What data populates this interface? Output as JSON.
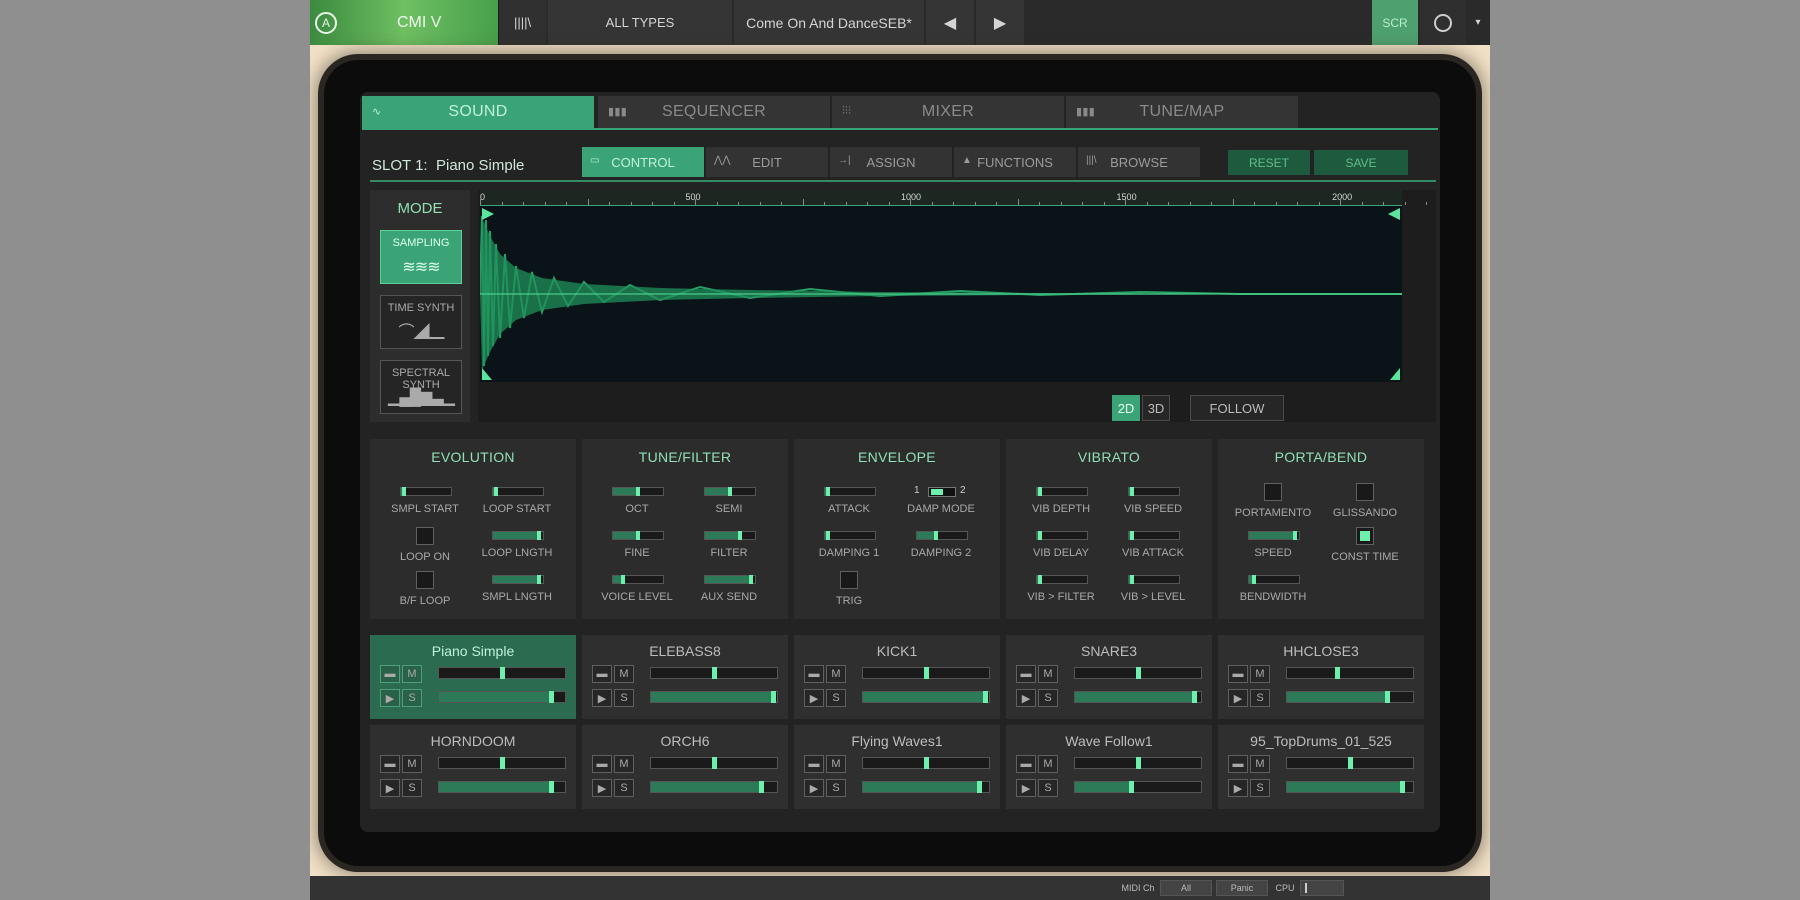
{
  "topbar": {
    "logo_glyph": "A",
    "app_name": "CMI V",
    "library_icon": "||||\\",
    "type_filter": "ALL TYPES",
    "preset_name": "Come On And DanceSEB*",
    "prev_icon": "◀",
    "next_icon": "▶",
    "scr_label": "SCR",
    "menu_icon": "▾"
  },
  "main_tabs": [
    {
      "label": "SOUND",
      "icon": "∿",
      "active": true
    },
    {
      "label": "SEQUENCER",
      "icon": "▮▮▮",
      "active": false
    },
    {
      "label": "MIXER",
      "icon": "⫶⫶⫶",
      "active": false
    },
    {
      "label": "TUNE/MAP",
      "icon": "▮▮▮",
      "active": false
    }
  ],
  "slot": {
    "label": "SLOT 1:",
    "name": "Piano Simple"
  },
  "sub_tabs": [
    {
      "label": "CONTROL",
      "icon": "▭",
      "active": true
    },
    {
      "label": "EDIT",
      "icon": "⋀⋀",
      "active": false
    },
    {
      "label": "ASSIGN",
      "icon": "→|",
      "active": false
    },
    {
      "label": "FUNCTIONS",
      "icon": "▲",
      "active": false
    },
    {
      "label": "BROWSE",
      "icon": "|||\\",
      "active": false
    }
  ],
  "slot_buttons": {
    "reset": "RESET",
    "save": "SAVE"
  },
  "mode": {
    "title": "MODE",
    "options": [
      {
        "label": "SAMPLING",
        "glyph": "≋≋≋",
        "active": true
      },
      {
        "label": "TIME SYNTH",
        "glyph": "⌒◢▁",
        "active": false
      },
      {
        "label": "SPECTRAL SYNTH",
        "glyph": "▁▄█▆▃▁",
        "active": false
      }
    ]
  },
  "waveform": {
    "ruler_ticks": [
      "0",
      "500",
      "1000",
      "1500",
      "2000"
    ],
    "view_2d": "2D",
    "view_3d": "3D",
    "follow": "FOLLOW",
    "active_view": "2D"
  },
  "sections": [
    {
      "title": "EVOLUTION",
      "controls": [
        {
          "type": "slider",
          "label": "SMPL START",
          "value": 0.05
        },
        {
          "type": "slider",
          "label": "LOOP START",
          "value": 0.05
        },
        {
          "type": "checkbox",
          "label": "LOOP ON",
          "checked": false
        },
        {
          "type": "slider",
          "label": "LOOP LNGTH",
          "value": 0.92
        },
        {
          "type": "checkbox",
          "label": "B/F LOOP",
          "checked": false
        },
        {
          "type": "slider",
          "label": "SMPL LNGTH",
          "value": 0.92
        }
      ]
    },
    {
      "title": "TUNE/FILTER",
      "controls": [
        {
          "type": "slider",
          "label": "OCT",
          "value": 0.5
        },
        {
          "type": "slider",
          "label": "SEMI",
          "value": 0.5
        },
        {
          "type": "slider",
          "label": "FINE",
          "value": 0.5
        },
        {
          "type": "slider",
          "label": "FILTER",
          "value": 0.7
        },
        {
          "type": "slider",
          "label": "VOICE LEVEL",
          "value": 0.2
        },
        {
          "type": "slider",
          "label": "AUX SEND",
          "value": 0.92
        }
      ]
    },
    {
      "title": "ENVELOPE",
      "controls": [
        {
          "type": "slider",
          "label": "ATTACK",
          "value": 0.05
        },
        {
          "type": "toggle",
          "label": "DAMP MODE",
          "left": "1",
          "right": "2"
        },
        {
          "type": "slider",
          "label": "DAMPING 1",
          "value": 0.05
        },
        {
          "type": "slider",
          "label": "DAMPING 2",
          "value": 0.38
        },
        {
          "type": "checkbox",
          "label": "TRIG",
          "checked": false
        }
      ]
    },
    {
      "title": "VIBRATO",
      "controls": [
        {
          "type": "slider",
          "label": "VIB DEPTH",
          "value": 0.05
        },
        {
          "type": "slider",
          "label": "VIB SPEED",
          "value": 0.05
        },
        {
          "type": "slider",
          "label": "VIB DELAY",
          "value": 0.05
        },
        {
          "type": "slider",
          "label": "VIB ATTACK",
          "value": 0.05
        },
        {
          "type": "slider",
          "label": "VIB > FILTER",
          "value": 0.05
        },
        {
          "type": "slider",
          "label": "VIB > LEVEL",
          "value": 0.05
        }
      ]
    },
    {
      "title": "PORTA/BEND",
      "controls": [
        {
          "type": "checkbox",
          "label": "PORTAMENTO",
          "checked": false
        },
        {
          "type": "checkbox",
          "label": "GLISSANDO",
          "checked": false
        },
        {
          "type": "slider",
          "label": "SPEED",
          "value": 0.92
        },
        {
          "type": "checkbox",
          "label": "CONST TIME",
          "checked": true
        },
        {
          "type": "slider",
          "label": "BENDWIDTH",
          "value": 0.1
        }
      ]
    }
  ],
  "instruments": [
    {
      "name": "Piano Simple",
      "active": true,
      "pan": 0.5,
      "level": 0.9
    },
    {
      "name": "ELEBASS8",
      "active": false,
      "pan": 0.5,
      "level": 0.98
    },
    {
      "name": "KICK1",
      "active": false,
      "pan": 0.5,
      "level": 0.98
    },
    {
      "name": "SNARE3",
      "active": false,
      "pan": 0.5,
      "level": 0.95
    },
    {
      "name": "HHCLOSE3",
      "active": false,
      "pan": 0.4,
      "level": 0.8
    },
    {
      "name": "HORNDOOM",
      "active": false,
      "pan": 0.5,
      "level": 0.9
    },
    {
      "name": "ORCH6",
      "active": false,
      "pan": 0.5,
      "level": 0.88
    },
    {
      "name": "Flying Waves1",
      "active": false,
      "pan": 0.5,
      "level": 0.93
    },
    {
      "name": "Wave Follow1",
      "active": false,
      "pan": 0.5,
      "level": 0.45
    },
    {
      "name": "95_TopDrums_01_525",
      "active": false,
      "pan": 0.5,
      "level": 0.92
    }
  ],
  "instrument_buttons": {
    "folder": "▬",
    "mute": "M",
    "play": "▶",
    "solo": "S"
  },
  "statusbar": {
    "midi_label": "MIDI Ch",
    "midi_value": "All",
    "panic": "Panic",
    "cpu_label": "CPU"
  }
}
